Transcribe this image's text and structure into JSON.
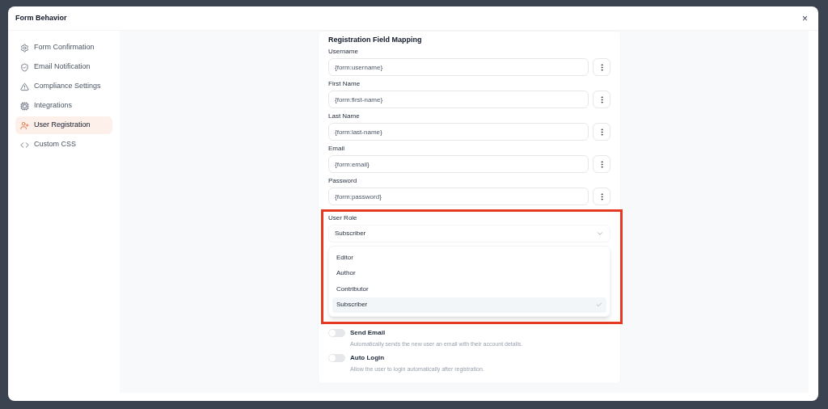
{
  "dialog": {
    "title": "Form Behavior",
    "close": "×"
  },
  "sidebar": {
    "items": [
      {
        "label": "Form Confirmation",
        "kind": "gear",
        "selected": false
      },
      {
        "label": "Email Notification",
        "kind": "shield",
        "selected": false
      },
      {
        "label": "Compliance Settings",
        "kind": "warning",
        "selected": false
      },
      {
        "label": "Integrations",
        "kind": "chip",
        "selected": false
      },
      {
        "label": "User Registration",
        "kind": "user-plus",
        "selected": true
      },
      {
        "label": "Custom CSS",
        "kind": "code",
        "selected": false
      }
    ]
  },
  "mapping": {
    "title": "Registration Field Mapping",
    "fields": [
      {
        "label": "Username",
        "value": "{form:username}"
      },
      {
        "label": "First Name",
        "value": "{form:first-name}"
      },
      {
        "label": "Last Name",
        "value": "{form:last-name}"
      },
      {
        "label": "Email",
        "value": "{form:email}"
      },
      {
        "label": "Password",
        "value": "{form:password}"
      }
    ]
  },
  "user_role": {
    "label": "User Role",
    "value": "Subscriber",
    "expanded": true,
    "options": [
      {
        "label": "Editor",
        "selected": false
      },
      {
        "label": "Author",
        "selected": false
      },
      {
        "label": "Contributor",
        "selected": false
      },
      {
        "label": "Subscriber",
        "selected": true
      }
    ]
  },
  "toggles": [
    {
      "label": "Send Email",
      "description": "Automatically sends the new user an email with their account details.",
      "on": false
    },
    {
      "label": "Auto Login",
      "description": "Allow the user to login automatically after registration.",
      "on": false
    }
  ]
}
